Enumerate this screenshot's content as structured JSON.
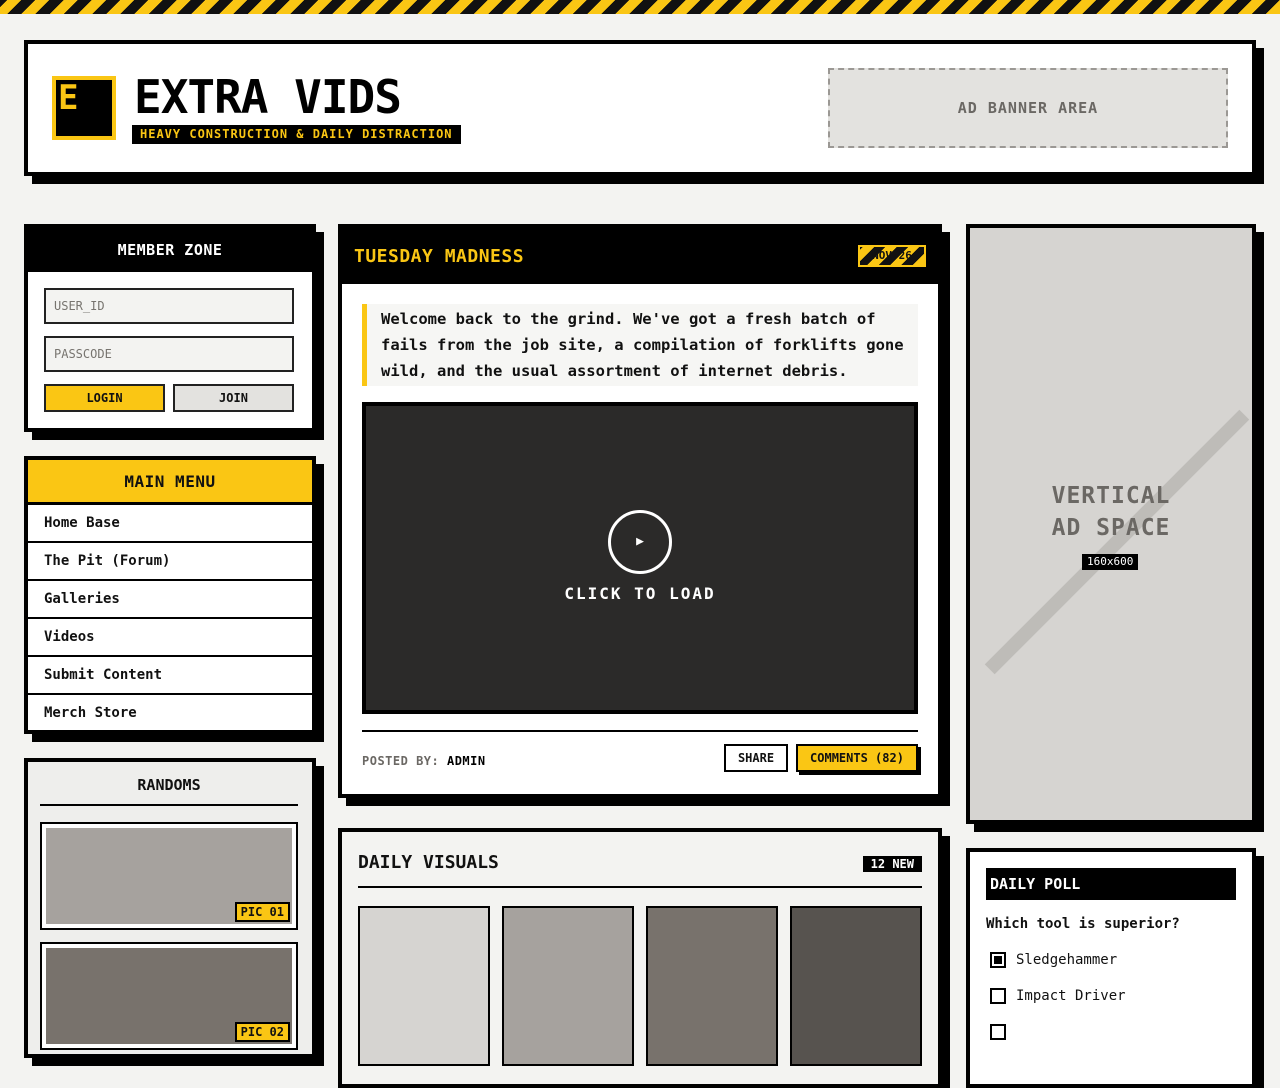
{
  "brand": {
    "logo_letter": "E",
    "title": "EXTRA VIDS",
    "tagline": "HEAVY CONSTRUCTION & DAILY DISTRACTION",
    "accent_color": "#fac614",
    "dark_color": "#000000"
  },
  "header": {
    "ad_banner_text": "AD BANNER AREA"
  },
  "member_zone": {
    "title": "MEMBER ZONE",
    "user_placeholder": "USER_ID",
    "pass_placeholder": "PASSCODE",
    "login_label": "LOGIN",
    "join_label": "JOIN"
  },
  "main_menu": {
    "title": "MAIN MENU",
    "items": [
      {
        "label": "Home Base"
      },
      {
        "label": "The Pit (Forum)"
      },
      {
        "label": "Galleries"
      },
      {
        "label": "Videos"
      },
      {
        "label": "Submit Content"
      },
      {
        "label": "Merch Store"
      }
    ]
  },
  "randoms": {
    "title": "RANDOMS",
    "pics": [
      {
        "tag": "PIC 01",
        "color": "#a6a29e"
      },
      {
        "tag": "PIC 02",
        "color": "#78726c"
      }
    ]
  },
  "post": {
    "title": "TUESDAY MADNESS",
    "date": "NOV 26",
    "intro": "Welcome back to the grind. We've got a fresh batch of fails from the job site, a compilation of forklifts gone wild, and the usual assortment of internet debris.",
    "video_label": "CLICK TO LOAD",
    "play_glyph": "▶",
    "posted_by_label": "POSTED BY:",
    "author": "ADMIN",
    "share_label": "SHARE",
    "comments_label": "COMMENTS (82)"
  },
  "daily_visuals": {
    "title": "DAILY VISUALS",
    "badge": "12 NEW",
    "thumb_colors": [
      "#d6d4d1",
      "#a6a29e",
      "#78726c",
      "#57534f"
    ]
  },
  "vertical_ad": {
    "line1": "VERTICAL",
    "line2": "AD SPACE",
    "size": "160x600"
  },
  "poll": {
    "title": "DAILY POLL",
    "question": "Which tool is superior?",
    "options": [
      {
        "label": "Sledgehammer",
        "checked": true
      },
      {
        "label": "Impact Driver",
        "checked": false
      }
    ]
  }
}
